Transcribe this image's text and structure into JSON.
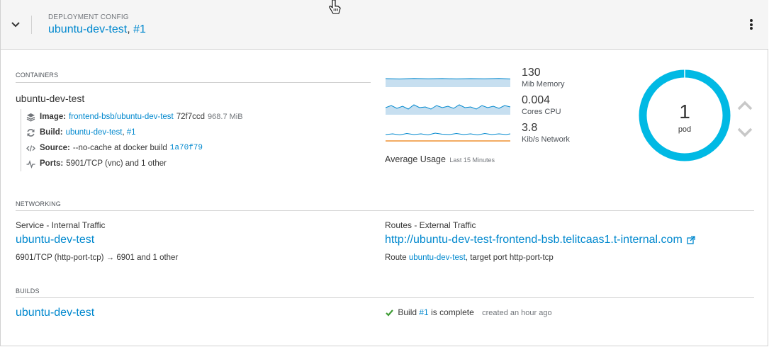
{
  "header": {
    "kind": "DEPLOYMENT CONFIG",
    "name": "ubuntu-dev-test",
    "separator": ",",
    "revision": "#1"
  },
  "containers": {
    "title": "CONTAINERS",
    "name": "ubuntu-dev-test",
    "image": {
      "label": "Image:",
      "ref": "frontend-bsb/ubuntu-dev-test",
      "id": "72f7ccd",
      "size": "968.7 MiB"
    },
    "build": {
      "label": "Build:",
      "name": "ubuntu-dev-test",
      "sep": ",",
      "num": "#1"
    },
    "source": {
      "label": "Source:",
      "text": "--no-cache at docker build",
      "commit": "1a70f79"
    },
    "ports": {
      "label": "Ports:",
      "text": "5901/TCP (vnc) and 1 other"
    }
  },
  "metrics": {
    "memory": {
      "value": "130",
      "unit": "Mib Memory"
    },
    "cpu": {
      "value": "0.004",
      "unit": "Cores CPU"
    },
    "network": {
      "value": "3.8",
      "unit": "Kib/s Network"
    },
    "average_label": "Average Usage",
    "average_period": "Last 15 Minutes"
  },
  "pods": {
    "count": "1",
    "label": "pod"
  },
  "networking": {
    "title": "NETWORKING",
    "service_label": "Service - Internal Traffic",
    "service_name": "ubuntu-dev-test",
    "service_ports": "6901/TCP (http-port-tcp) → 6901 and 1 other",
    "routes_label": "Routes - External Traffic",
    "route_url": "http://ubuntu-dev-test-frontend-bsb.telitcaas1.t-internal.com",
    "route_prefix": "Route",
    "route_name": "ubuntu-dev-test",
    "route_target": ", target port http-port-tcp"
  },
  "builds": {
    "title": "BUILDS",
    "name": "ubuntu-dev-test",
    "status_prefix": "Build",
    "build_num": "#1",
    "status_suffix": "is complete",
    "created": "created an hour ago"
  },
  "colors": {
    "accent": "#0088ce",
    "donut": "#00b9e4",
    "sparkline": "#0088ce",
    "fill": "#c7dff0",
    "network_out": "#ec7a08",
    "success": "#3f9c35"
  },
  "icons": [
    "chevron-down-icon",
    "kebab-icon",
    "layers-icon",
    "refresh-icon",
    "code-icon",
    "pulse-icon",
    "external-link-icon",
    "check-icon",
    "angle-up-icon",
    "angle-down-icon",
    "cursor-hand-icon"
  ]
}
